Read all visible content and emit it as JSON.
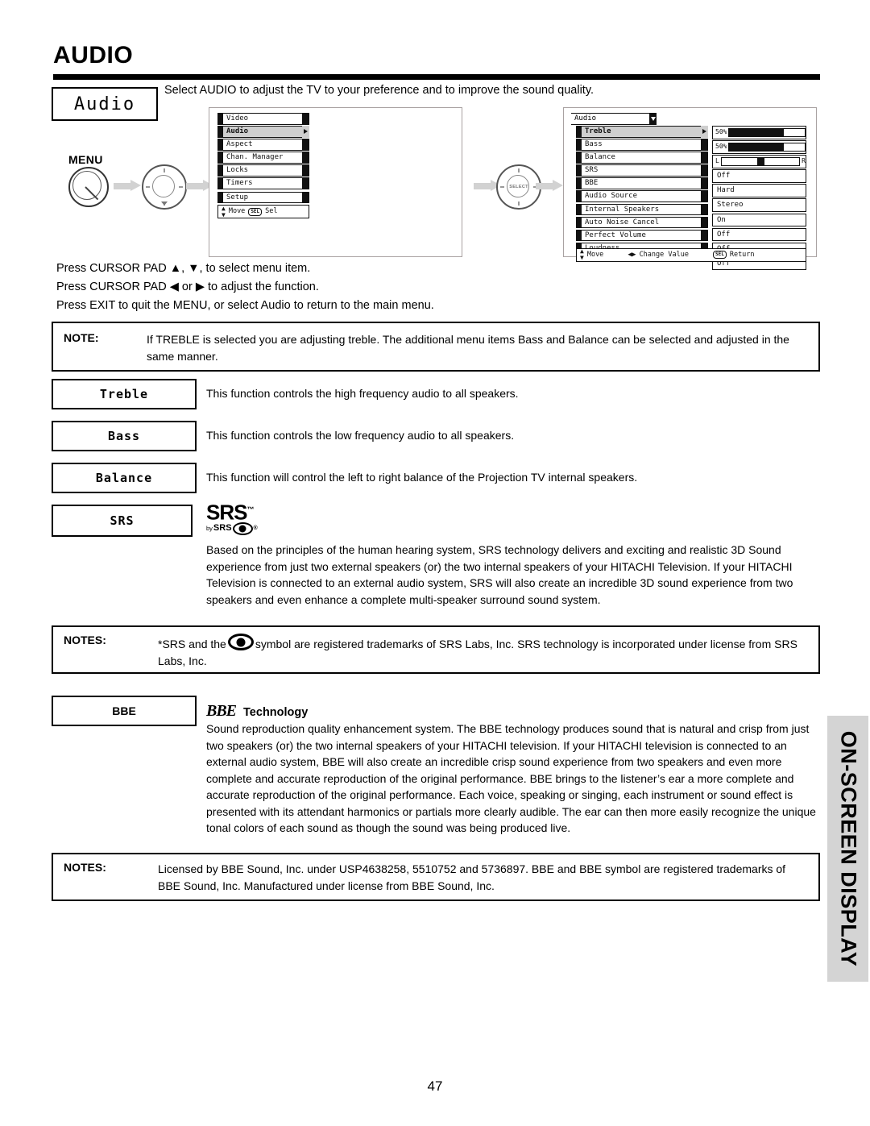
{
  "page": {
    "title": "AUDIO",
    "number": "47",
    "side_tab": "ON-SCREEN DISPLAY"
  },
  "header": {
    "tag_label": "Audio",
    "intro": "Select AUDIO to adjust the TV to your preference and to improve the sound quality."
  },
  "remote": {
    "menu_label": "MENU",
    "select_label": "SELECT"
  },
  "main_menu": {
    "items": [
      "Video",
      "Audio",
      "Aspect",
      "Chan. Manager",
      "Locks",
      "Timers",
      "Setup"
    ],
    "selected": "Audio",
    "footer_move": "Move",
    "footer_sel_chip": "SEL",
    "footer_sel": "Sel"
  },
  "audio_menu": {
    "header": "Audio",
    "rows": [
      {
        "label": "Treble",
        "value": "50%",
        "type": "meter",
        "percent": 50,
        "selected": true
      },
      {
        "label": "Bass",
        "value": "50%",
        "type": "meter",
        "percent": 50,
        "selected": false
      },
      {
        "label": "Balance",
        "value": "",
        "type": "balance",
        "left": "L",
        "right": "R",
        "position": 50,
        "selected": false
      },
      {
        "label": "SRS",
        "value": "Off",
        "type": "text",
        "selected": false
      },
      {
        "label": "BBE",
        "value": "Hard",
        "type": "text",
        "selected": false
      },
      {
        "label": "Audio Source",
        "value": "Stereo",
        "type": "text",
        "selected": false
      },
      {
        "label": "Internal Speakers",
        "value": "On",
        "type": "text",
        "selected": false
      },
      {
        "label": "Auto Noise Cancel",
        "value": "Off",
        "type": "text",
        "selected": false
      },
      {
        "label": "Perfect Volume",
        "value": "Off",
        "type": "text",
        "selected": false
      },
      {
        "label": "Loudness",
        "value": "Off",
        "type": "text",
        "selected": false
      }
    ],
    "footer_move": "Move",
    "footer_change": "Change Value",
    "footer_sel_chip": "SEL",
    "footer_return": "Return"
  },
  "instructions": [
    "Press CURSOR PAD ▲, ▼, to select menu item.",
    "Press CURSOR PAD  ◀ or ▶ to adjust the function.",
    "Press EXIT to quit the MENU, or select Audio to return to the main menu."
  ],
  "note_top": {
    "label": "NOTE:",
    "text": "If TREBLE is selected you are adjusting treble.  The additional menu items Bass and Balance can be selected and adjusted in the same manner."
  },
  "features": [
    {
      "name": "Treble",
      "desc": "This function controls the high frequency audio to all speakers."
    },
    {
      "name": "Bass",
      "desc": "This function controls the low frequency audio to all speakers."
    },
    {
      "name": "Balance",
      "desc": "This function will control the left to right balance of the Projection TV internal speakers."
    },
    {
      "name": "SRS",
      "desc": ""
    }
  ],
  "srs": {
    "logo_main": "SRS",
    "logo_by": "by",
    "logo_sub": "SRS",
    "logo_sup": "®",
    "body": "Based on the principles of the human hearing system, SRS technology delivers and exciting and realistic 3D Sound experience from just two external speakers (or) the two internal speakers of your HITACHI Television.  If your HITACHI Television is connected to an external audio system, SRS will also create an incredible 3D sound experience from two speakers and even enhance a complete multi-speaker surround sound system.",
    "note_label": "NOTES:",
    "note_part1": "*SRS and the",
    "note_part2": "symbol are registered trademarks of SRS Labs, Inc. SRS technology is incorporated under license from SRS Labs, Inc."
  },
  "bbe": {
    "box_label": "BBE",
    "logo": "BBE",
    "heading": "Technology",
    "body": "Sound reproduction quality enhancement system.  The BBE technology produces sound that is natural and crisp from just two speakers (or) the two internal speakers of your HITACHI television. If your HITACHI television is connected to an external audio system, BBE will also create an incredible crisp sound experience from two speakers and even more complete and accurate reproduction of the original performance. BBE brings to the listener’s ear a more complete and accurate reproduction of the original performance. Each voice, speaking or singing, each instrument or sound effect is presented with its attendant harmonics or partials more clearly audible.  The ear can then more easily recognize the unique tonal colors of each sound as though the sound was being produced live.",
    "note_label": "NOTES:",
    "note_text": "Licensed by BBE Sound, Inc. under USP4638258, 5510752 and 5736897.  BBE and BBE symbol are registered trademarks of BBE Sound, Inc.  Manufactured under license from BBE Sound, Inc."
  }
}
